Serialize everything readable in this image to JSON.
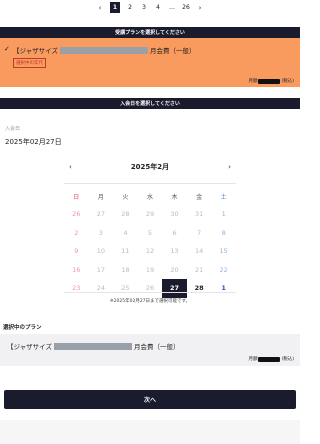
{
  "pagination": {
    "prev": "‹",
    "pages": [
      "1",
      "2",
      "3",
      "4",
      "…",
      "26"
    ],
    "active_index": 0,
    "next": "›"
  },
  "plan_bar": {
    "label": "受講プランを選択してください"
  },
  "plan": {
    "title_prefix": "【ジャザサイズ",
    "title_suffix": "月会費（一般）",
    "badge": "選択中の年代",
    "price_prefix": "月額",
    "price_suffix": "(税込)",
    "check": "✓"
  },
  "join_bar": {
    "label": "入会日を選択してください"
  },
  "join_date": {
    "label": "入会日",
    "value": "2025年02月27日"
  },
  "calendar": {
    "prev": "‹",
    "next": "›",
    "month_label": "2025年2月",
    "weekdays": [
      "日",
      "月",
      "火",
      "水",
      "木",
      "金",
      "土"
    ],
    "weeks": [
      [
        "26",
        "27",
        "28",
        "29",
        "30",
        "31",
        "1"
      ],
      [
        "2",
        "3",
        "4",
        "5",
        "6",
        "7",
        "8"
      ],
      [
        "9",
        "10",
        "11",
        "12",
        "13",
        "14",
        "15"
      ],
      [
        "16",
        "17",
        "18",
        "19",
        "20",
        "21",
        "22"
      ],
      [
        "23",
        "24",
        "25",
        "26",
        "27",
        "28",
        "1"
      ]
    ],
    "selected": "27",
    "note": "※2025年02月27日まで選択可能です。"
  },
  "current_plan": {
    "heading": "選択中のプラン",
    "title_prefix": "【ジャザサイズ",
    "title_suffix": "月会費（一般）",
    "price_prefix": "月額",
    "price_suffix": "(税込)"
  },
  "actions": {
    "next_label": "次へ"
  }
}
